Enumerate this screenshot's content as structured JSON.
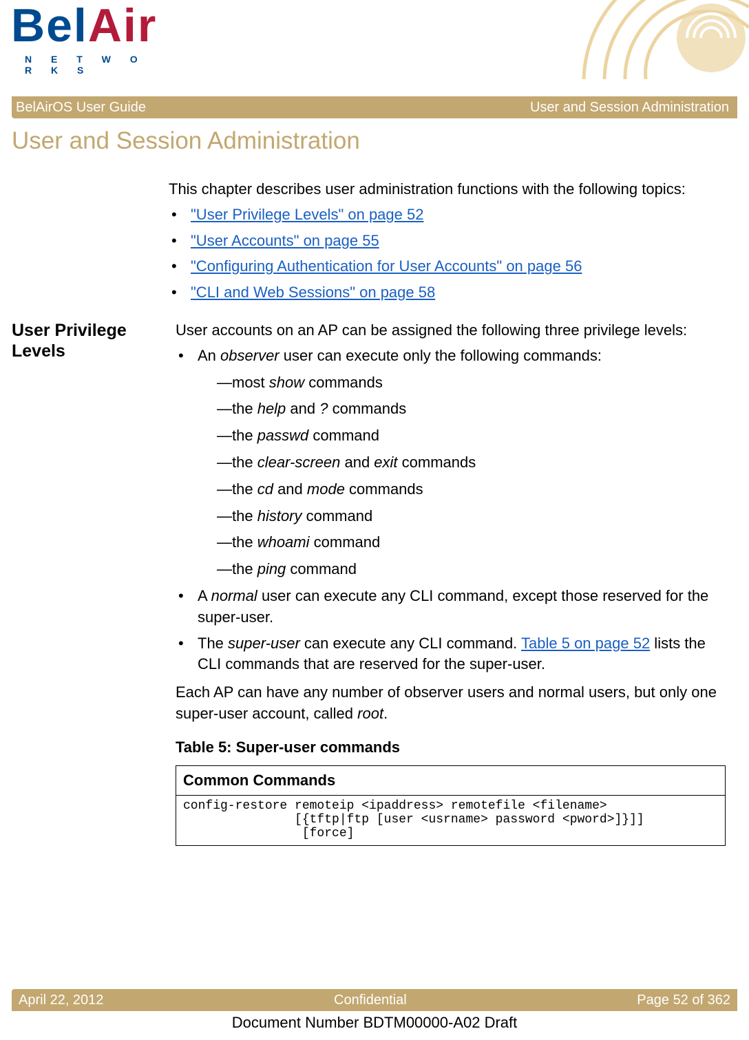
{
  "logo": {
    "main": "BelAir",
    "sub": "N E T W O R K S"
  },
  "bar_top": {
    "left": "BelAirOS User Guide",
    "right": "User and Session Administration"
  },
  "h1": "User and Session Administration",
  "intro": {
    "lead": "This chapter describes user administration functions with the following topics:",
    "links": [
      "\"User Privilege Levels\" on page 52",
      "\"User Accounts\" on page 55",
      "\"Configuring Authentication for User Accounts\" on page 56",
      "\"CLI and Web Sessions\" on page 58"
    ]
  },
  "section": {
    "heading": "User Privilege Levels",
    "lead": "User accounts on an AP can be assigned the following three privilege levels:",
    "bullets": {
      "observer_lead_pre": "An ",
      "observer_lead_ital": "observer",
      "observer_lead_post": " user can execute only the following commands:",
      "observer_cmds": [
        {
          "pre": "most ",
          "i1": "show",
          "mid": " commands"
        },
        {
          "pre": "the ",
          "i1": "help",
          "mid": " and ",
          "i2": "?",
          "post": " commands"
        },
        {
          "pre": "the ",
          "i1": "passwd",
          "mid": " command"
        },
        {
          "pre": "the ",
          "i1": "clear-screen",
          "mid": " and ",
          "i2": "exit",
          "post": " commands"
        },
        {
          "pre": "the ",
          "i1": "cd",
          "mid": " and ",
          "i2": "mode",
          "post": " commands"
        },
        {
          "pre": "the ",
          "i1": "history",
          "mid": " command"
        },
        {
          "pre": "the ",
          "i1": "whoami",
          "mid": " command"
        },
        {
          "pre": "the ",
          "i1": "ping",
          "mid": " command"
        }
      ],
      "normal_pre": "A ",
      "normal_ital": "normal",
      "normal_post": " user can execute any CLI command, except those reserved for the super-user.",
      "super_pre": "The ",
      "super_ital": "super-user",
      "super_mid": " can execute any CLI command. ",
      "super_link": "Table 5 on page 52",
      "super_post": " lists the CLI commands that are reserved for the super-user."
    },
    "trailing_pre": "Each AP can have any number of observer users and normal users, but only one super-user account, called ",
    "trailing_ital": "root",
    "trailing_post": ".",
    "table_title": "Table 5: Super-user commands",
    "table_header": "Common Commands",
    "table_cell": "config-restore remoteip <ipaddress> remotefile <filename>\n               [{tftp|ftp [user <usrname> password <pword>]}]]\n                [force]"
  },
  "bar_bottom": {
    "left": "April 22, 2012",
    "center": "Confidential",
    "right": "Page 52 of 362"
  },
  "docnum": "Document Number BDTM00000-A02 Draft"
}
